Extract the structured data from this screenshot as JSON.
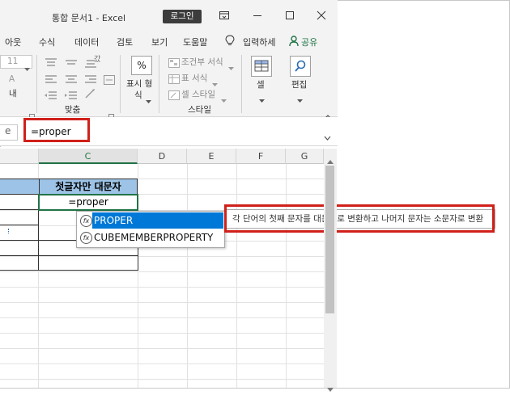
{
  "window": {
    "title": "통합 문서1  -  Excel",
    "login_label": "로그인"
  },
  "menu": {
    "items": [
      "아웃",
      "수식",
      "데이터",
      "검토",
      "보기",
      "도움말"
    ],
    "tell_me": "입력하세",
    "share": "공유"
  },
  "ribbon": {
    "font_size": "11",
    "alignment_group": "맞춤",
    "number_label_line1": "표시 형",
    "number_label_line2": "식",
    "percent_symbol": "%",
    "conditional_format": "조건부 서식",
    "table_format": "표 서식",
    "cell_style": "셀 스타일",
    "styles_group": "스타일",
    "cells_label": "셀",
    "editing_label": "편집",
    "wrap_label": "갔",
    "indent_label": "내"
  },
  "formula_bar": {
    "name_box_tail": "e",
    "formula": "=proper"
  },
  "grid": {
    "columns": [
      "C",
      "D",
      "E",
      "F",
      "G"
    ],
    "header_cell": "첫글자만 대문자",
    "active_cell_value": "=proper"
  },
  "autocomplete": {
    "items": [
      {
        "icon": "fx",
        "label": "PROPER",
        "selected": true
      },
      {
        "icon": "fx",
        "label": "CUBEMEMBERPROPERTY",
        "selected": false
      }
    ],
    "tooltip": "각 단어의 첫째 문자를 대문자로 변환하고 나머지 문자는 소문자로 변환"
  },
  "colors": {
    "highlight_red": "#d0201a",
    "header_fill": "#9dc3e6",
    "selection_blue": "#0078d7",
    "active_border": "#217346",
    "share_green": "#217346"
  }
}
